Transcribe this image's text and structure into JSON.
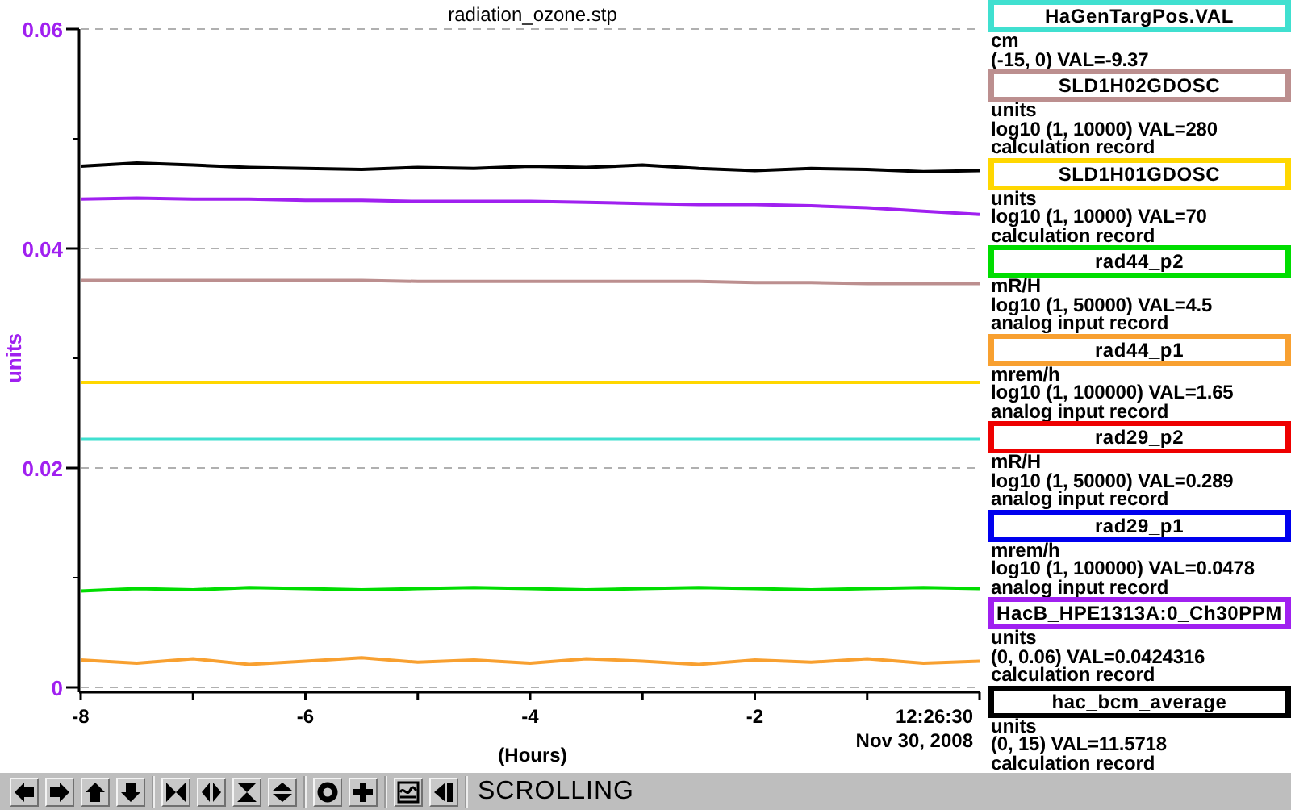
{
  "plot": {
    "timestamp": {
      "time": "12:26:30",
      "date": "Nov 30, 2008"
    },
    "chart_data": {
      "type": "line",
      "title": "radiation_ozone.stp",
      "xlabel": "(Hours)",
      "ylabel": "units",
      "x": [
        -8,
        -7.5,
        -7,
        -6.5,
        -6,
        -5.5,
        -5,
        -4.5,
        -4,
        -3.5,
        -3,
        -2.5,
        -2,
        -1.5,
        -1,
        -0.5,
        0
      ],
      "xlim": [
        -8,
        0
      ],
      "ylim": [
        0,
        0.06
      ],
      "xticks": [
        -8,
        -6,
        -4,
        -2
      ],
      "yticks": [
        {
          "value": 0,
          "label": "0"
        },
        {
          "value": 0.02,
          "label": "0.02"
        },
        {
          "value": 0.04,
          "label": "0.04"
        },
        {
          "value": 0.06,
          "label": "0.06"
        }
      ],
      "series": [
        {
          "color": "#40e0d0",
          "values": [
            0.0226,
            0.0226,
            0.0226,
            0.0226,
            0.0226,
            0.0226,
            0.0226,
            0.0226,
            0.0226,
            0.0226,
            0.0226,
            0.0226,
            0.0226,
            0.0226,
            0.0226,
            0.0226,
            0.0226
          ]
        },
        {
          "color": "#bc8f8f",
          "values": [
            0.0371,
            0.0371,
            0.0371,
            0.0371,
            0.0371,
            0.0371,
            0.037,
            0.037,
            0.037,
            0.037,
            0.037,
            0.037,
            0.0369,
            0.0369,
            0.0368,
            0.0368,
            0.0368
          ]
        },
        {
          "color": "#ffd700",
          "values": [
            0.0278,
            0.0278,
            0.0278,
            0.0278,
            0.0278,
            0.0278,
            0.0278,
            0.0278,
            0.0278,
            0.0278,
            0.0278,
            0.0278,
            0.0278,
            0.0278,
            0.0278,
            0.0278,
            0.0278
          ]
        },
        {
          "color": "#00dd00",
          "values": [
            0.0088,
            0.009,
            0.0089,
            0.0091,
            0.009,
            0.0089,
            0.009,
            0.0091,
            0.009,
            0.0089,
            0.009,
            0.0091,
            0.009,
            0.0089,
            0.009,
            0.0091,
            0.009
          ]
        },
        {
          "color": "#f8a030",
          "values": [
            0.0025,
            0.0022,
            0.0026,
            0.0021,
            0.0024,
            0.0027,
            0.0023,
            0.0025,
            0.0022,
            0.0026,
            0.0024,
            0.0021,
            0.0025,
            0.0023,
            0.0026,
            0.0022,
            0.0024
          ]
        },
        {
          "color": "#a020f0",
          "values": [
            0.0445,
            0.0446,
            0.0445,
            0.0445,
            0.0444,
            0.0444,
            0.0443,
            0.0443,
            0.0443,
            0.0442,
            0.0441,
            0.044,
            0.044,
            0.0439,
            0.0437,
            0.0434,
            0.0431
          ]
        },
        {
          "color": "#000000",
          "values": [
            0.0475,
            0.0478,
            0.0476,
            0.0474,
            0.0473,
            0.0472,
            0.0474,
            0.0473,
            0.0475,
            0.0474,
            0.0476,
            0.0473,
            0.0471,
            0.0473,
            0.0472,
            0.047,
            0.0471
          ]
        }
      ]
    }
  },
  "legend": [
    {
      "name": "HaGenTargPos.VAL",
      "color": "#40e0d0",
      "units": "cm",
      "range": "(-15, 0) VAL=-9.37"
    },
    {
      "name": "SLD1H02GDOSC",
      "color": "#bc8f8f",
      "units": "units",
      "range": "log10 (1, 10000) VAL=280",
      "record": "calculation record"
    },
    {
      "name": "SLD1H01GDOSC",
      "color": "#ffd700",
      "units": "units",
      "range": "log10 (1, 10000) VAL=70",
      "record": "calculation record"
    },
    {
      "name": "rad44_p2",
      "color": "#00dd00",
      "units": "mR/H",
      "range": "log10 (1, 50000) VAL=4.5",
      "record": "analog input record"
    },
    {
      "name": "rad44_p1",
      "color": "#f8a030",
      "units": "mrem/h",
      "range": "log10 (1, 100000) VAL=1.65",
      "record": "analog input record"
    },
    {
      "name": "rad29_p2",
      "color": "#ee0000",
      "units": "mR/H",
      "range": "log10 (1, 50000) VAL=0.289",
      "record": "analog input record"
    },
    {
      "name": "rad29_p1",
      "color": "#0000ee",
      "units": "mrem/h",
      "range": "log10 (1, 100000) VAL=0.0478",
      "record": "analog input record"
    },
    {
      "name": "HacB_HPE1313A:0_Ch30PPM",
      "color": "#a020f0",
      "units": "units",
      "range": "(0, 0.06) VAL=0.0424316",
      "record": "calculation record"
    },
    {
      "name": "hac_bcm_average",
      "color": "#000000",
      "units": "units",
      "range": "(0, 15) VAL=11.5718",
      "record": "calculation record"
    }
  ],
  "toolbar": {
    "status": "SCROLLING"
  }
}
